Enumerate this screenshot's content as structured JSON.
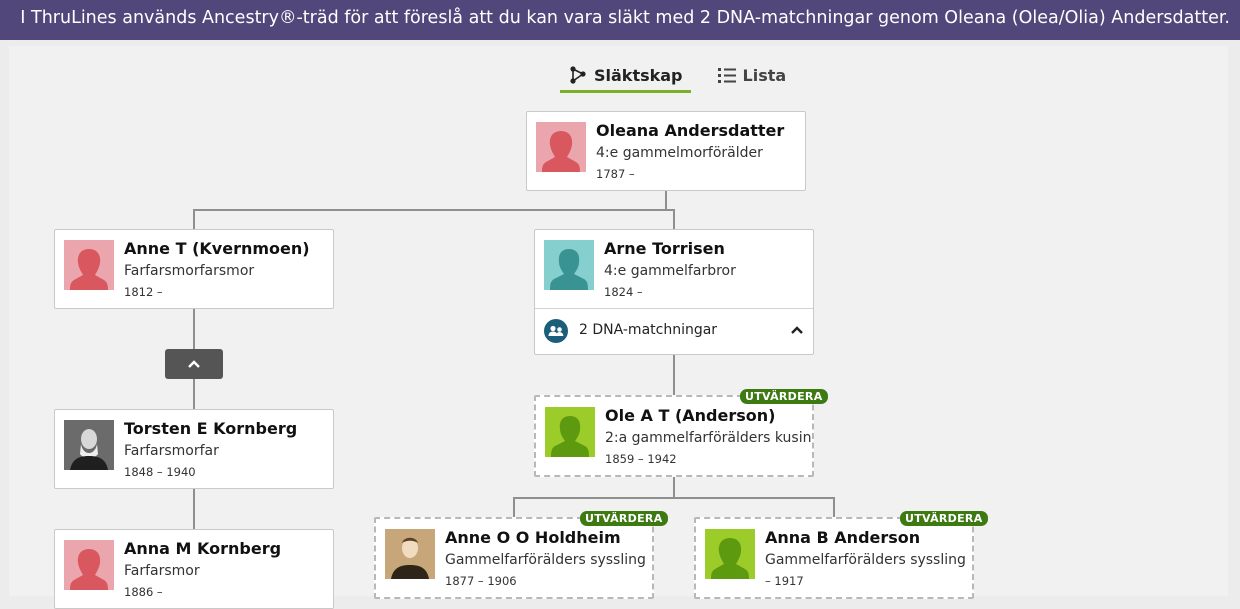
{
  "banner": {
    "text": "I ThruLines används Ancestry®-träd för att föreslå att du kan vara släkt med 2 DNA-matchningar genom Oleana (Olea/Olia) Andersdatter."
  },
  "tabs": [
    {
      "label": "Släktskap",
      "icon": "tree-icon",
      "active": true
    },
    {
      "label": "Lista",
      "icon": "list-icon",
      "active": false
    }
  ],
  "people": {
    "oleana": {
      "name": "Oleana Andersdatter",
      "relation": "4:e gammelmorförälder",
      "dates": "1787 –"
    },
    "anne_t": {
      "name": "Anne T (Kvernmoen)",
      "relation": "Farfarsmorfarsmor",
      "dates": "1812 –"
    },
    "arne": {
      "name": "Arne Torrisen",
      "relation": "4:e gammelfarbror",
      "dates": "1824 –"
    },
    "torsten": {
      "name": "Torsten E Kornberg",
      "relation": "Farfarsmorfar",
      "dates": "1848 – 1940"
    },
    "ole": {
      "name": "Ole A T (Anderson)",
      "relation": "2:a gammelfarförälders kusin",
      "dates": "1859 – 1942"
    },
    "anna_m": {
      "name": "Anna M Kornberg",
      "relation": "Farfarsmor",
      "dates": "1886 –"
    },
    "anne_o": {
      "name": "Anne O O Holdheim",
      "relation": "Gammelfarförälders syssling",
      "dates": "1877 – 1906"
    },
    "anna_b": {
      "name": "Anna B Anderson",
      "relation": "Gammelfarförälders syssling",
      "dates": "– 1917"
    }
  },
  "dna_matches": {
    "label": "2 DNA-matchningar"
  },
  "badge_label": "UTVÄRDERA",
  "colors": {
    "banner": "#51477a",
    "female": "#e8a0a8",
    "male": "#7cc4c4",
    "evaluate": "#8fc21a",
    "badge": "#3d7a12",
    "tab_underline": "#7cae2a"
  }
}
